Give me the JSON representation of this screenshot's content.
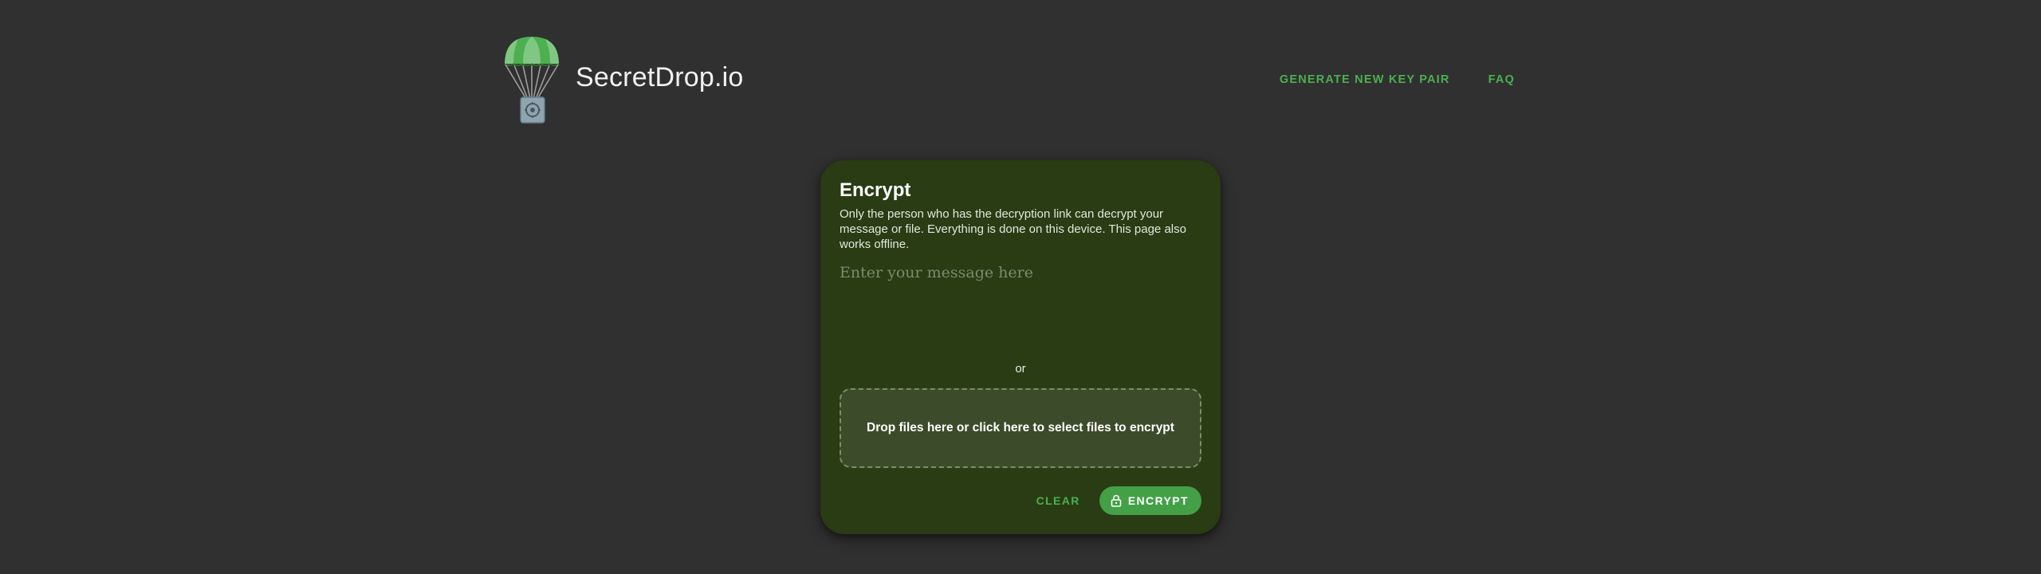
{
  "header": {
    "logo_icon": "parachute-safe-icon",
    "brand": "SecretDrop.io",
    "nav": [
      {
        "label": "GENERATE NEW KEY PAIR"
      },
      {
        "label": "FAQ"
      }
    ]
  },
  "card": {
    "title": "Encrypt",
    "description": "Only the person who has the decryption link can decrypt your message or file. Everything is done on this device. This page also works offline.",
    "message_input": {
      "placeholder": "Enter your message here",
      "value": ""
    },
    "or_label": "or",
    "dropzone_label": "Drop files here or click here to select files to encrypt",
    "actions": {
      "clear_label": "CLEAR",
      "encrypt_label": "ENCRYPT",
      "encrypt_icon": "lock-icon"
    }
  },
  "colors": {
    "background": "#303030",
    "card": "#293c14",
    "accent": "#4caf50",
    "button": "#43a047",
    "dropzone": "#3c4c2b"
  }
}
